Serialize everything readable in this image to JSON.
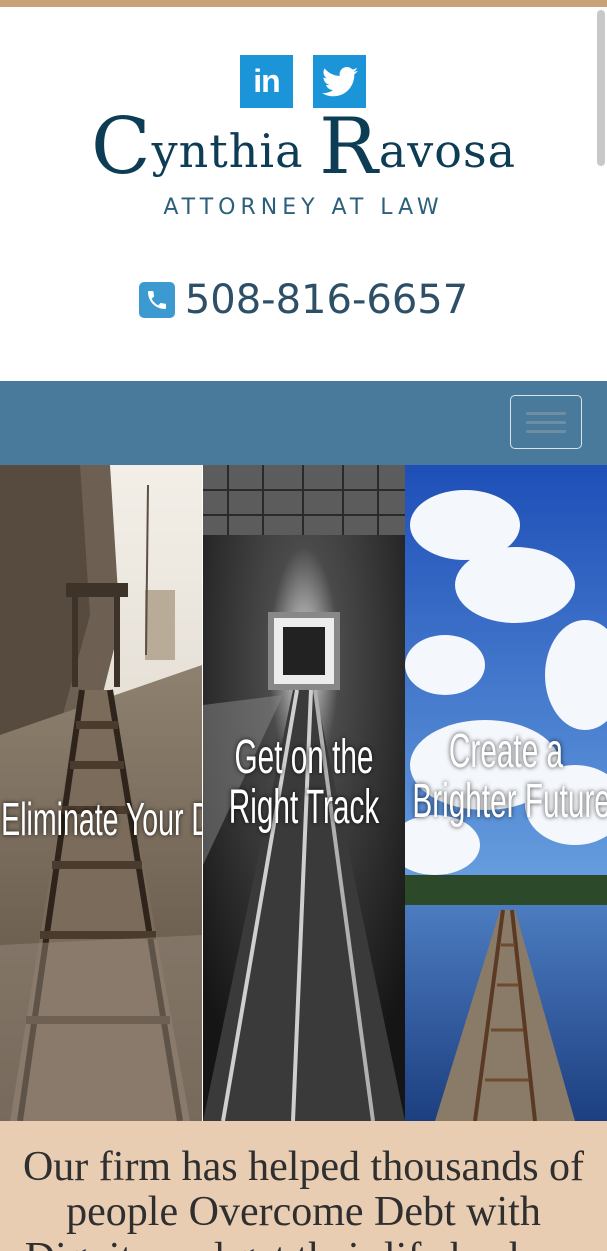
{
  "header": {
    "social": [
      {
        "label": "in",
        "icon": "linkedin-icon"
      },
      {
        "label": "",
        "icon": "twitter-icon"
      }
    ],
    "logo": {
      "name_first_cap": "C",
      "name_first_rest": "ynthia ",
      "name_last_cap": "R",
      "name_last_rest": "avosa",
      "subtitle": "ATTORNEY AT LAW"
    },
    "phone": {
      "number": "508-816-6657",
      "icon": "phone-icon"
    }
  },
  "navbar": {
    "toggle_icon": "hamburger-icon"
  },
  "hero": {
    "panels": [
      {
        "line1": "Eliminate Your Debt",
        "line2": ""
      },
      {
        "line1": "Get on the",
        "line2": "Right Track"
      },
      {
        "line1": "Create a",
        "line2": "Brighter Future"
      }
    ]
  },
  "intro": {
    "text": "Our firm has helped thousands of people Overcome Debt with Dignity and get their life back on"
  },
  "colors": {
    "accent_top": "#c9a27a",
    "navbar": "#4a7a9b",
    "logo_text": "#0d3d55",
    "strip": "#e8cdb3"
  }
}
